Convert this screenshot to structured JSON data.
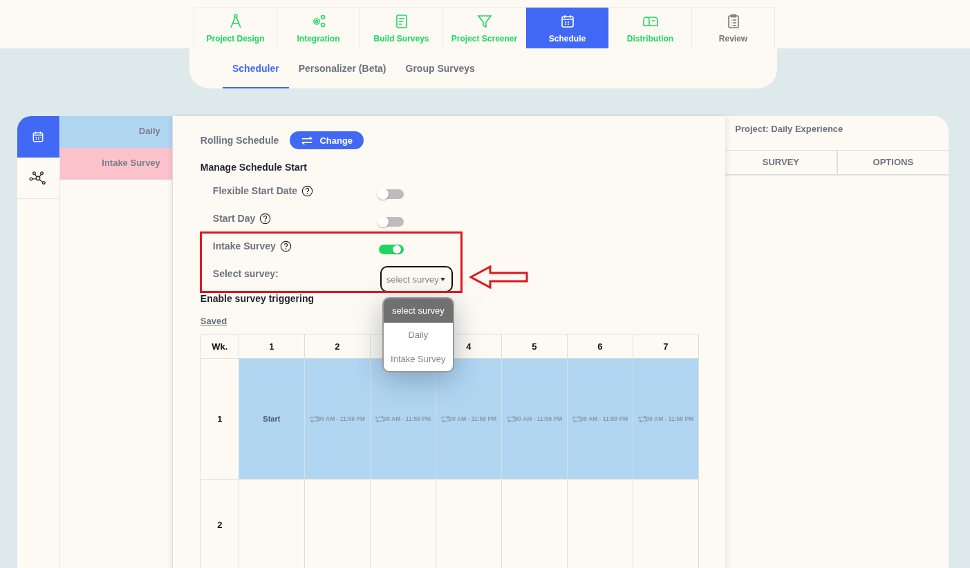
{
  "nav_tabs": [
    {
      "label": "Project Design",
      "selected": false,
      "disabled": false
    },
    {
      "label": "Integration",
      "selected": false,
      "disabled": false
    },
    {
      "label": "Build Surveys",
      "selected": false,
      "disabled": false
    },
    {
      "label": "Project Screener",
      "selected": false,
      "disabled": false
    },
    {
      "label": "Schedule",
      "selected": true,
      "disabled": false
    },
    {
      "label": "Distribution",
      "selected": false,
      "disabled": false
    },
    {
      "label": "Review",
      "selected": false,
      "disabled": true
    }
  ],
  "sub_tabs": [
    {
      "label": "Scheduler",
      "selected": true
    },
    {
      "label": "Personalizer (Beta)",
      "selected": false
    },
    {
      "label": "Group Surveys",
      "selected": false
    }
  ],
  "side_icons": [
    {
      "selected": true
    },
    {
      "selected": false
    }
  ],
  "surveys": [
    {
      "name": "Daily",
      "color": "#b0d6f2"
    },
    {
      "name": "Intake Survey",
      "color": "#fbc2cb"
    }
  ],
  "schedule_type": {
    "label": "Rolling Schedule",
    "button": "Change"
  },
  "manage_heading": "Manage Schedule Start",
  "settings": [
    {
      "label": "Flexible Start Date",
      "on": false
    },
    {
      "label": "Start Day",
      "on": false
    },
    {
      "label": "Intake Survey",
      "on": true
    }
  ],
  "select_survey": {
    "label": "Select survey:",
    "value": "select survey"
  },
  "dropdown_options": [
    {
      "label": "select survey",
      "selected": true
    },
    {
      "label": "Daily",
      "selected": false
    },
    {
      "label": "Intake Survey",
      "selected": false
    }
  ],
  "trigger_heading": "Enable survey triggering",
  "status": "Saved",
  "grid": {
    "columns": [
      {
        "label": "Wk."
      },
      {
        "label": "1"
      },
      {
        "label": "2"
      },
      {},
      {
        "label": "4"
      },
      {
        "label": "5"
      },
      {
        "label": "6"
      },
      {
        "label": "7"
      }
    ],
    "rows": [
      {
        "active": true,
        "cells": [
          {
            "kind": "week",
            "text": "1"
          },
          {
            "kind": "start",
            "text": "Start"
          },
          {
            "kind": "time",
            "text": "00 AM - 11:59 PM"
          },
          {
            "kind": "time",
            "text": "00 AM - 11:59 PM"
          },
          {
            "kind": "time",
            "text": "00 AM - 11:59 PM"
          },
          {
            "kind": "time",
            "text": "00 AM - 11:59 PM"
          },
          {
            "kind": "time",
            "text": "00 AM - 11:59 PM"
          },
          {
            "kind": "time",
            "text": "00 AM - 11:59 PM"
          }
        ]
      },
      {
        "active": false,
        "cells": [
          {
            "kind": "week",
            "text": "2"
          },
          {},
          {},
          {},
          {},
          {},
          {},
          {}
        ]
      }
    ]
  },
  "right_panel": {
    "title": "Project: Daily Experience",
    "columns": [
      "SURVEY",
      "OPTIONS"
    ]
  }
}
